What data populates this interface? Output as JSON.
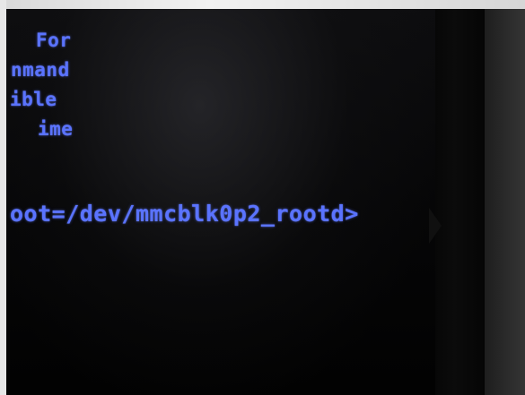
{
  "screen": {
    "lines": [
      "For",
      "nmand",
      "ible",
      "ime",
      "oot=/dev/mmcblk0p2_rootd>"
    ],
    "text_color": "#5a73ff",
    "background_color": "#000000"
  }
}
